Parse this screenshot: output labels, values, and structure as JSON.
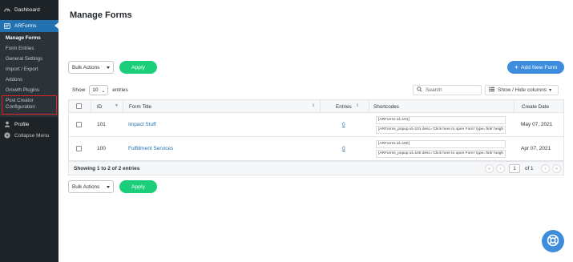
{
  "sidebar": {
    "dashboard_label": "Dashboard",
    "arforms_label": "ARForms",
    "submenu": [
      "Manage Forms",
      "Form Entries",
      "General Settings",
      "Import / Export",
      "Addons",
      "Growth Plugins",
      "Post Creator",
      "Configuration"
    ],
    "profile_label": "Profile",
    "collapse_label": "Collapse Menu"
  },
  "page": {
    "title": "Manage Forms"
  },
  "toolbar": {
    "bulk_actions": "Bulk Actions",
    "apply": "Apply",
    "add_new": "Add New Form"
  },
  "list_controls": {
    "show_label": "Show",
    "page_size": "10",
    "entries_label": "entries",
    "search_placeholder": "Search",
    "columns_label": "Show / Hide columns"
  },
  "table": {
    "headers": {
      "id": "ID",
      "form_title": "Form Title",
      "entries": "Entries",
      "shortcodes": "Shortcodes",
      "create_date": "Create Date"
    },
    "rows": [
      {
        "id": "101",
        "title": "Impact Stuff",
        "entries": "0",
        "shortcode1": "[ARForms id=101]",
        "shortcode2": "[ARForms_popup id=101 desc='Click here to open Form' type='link' heigh",
        "date": "May 07, 2021"
      },
      {
        "id": "100",
        "title": "Fulfillment Services",
        "entries": "0",
        "shortcode1": "[ARForms id=100]",
        "shortcode2": "[ARForms_popup id=100 desc='Click here to open Form' type='link' heigh",
        "date": "Apr 07, 2021"
      }
    ],
    "summary": "Showing 1 to 2 of 2 entries",
    "current_page": "1",
    "of_pages": "of 1"
  },
  "colors": {
    "sidebar_bg": "#1d2327",
    "accent_blue": "#2271b1",
    "apply_green": "#1bcf7a",
    "add_button_blue": "#3e8ddc",
    "highlight_red": "#e02424"
  }
}
